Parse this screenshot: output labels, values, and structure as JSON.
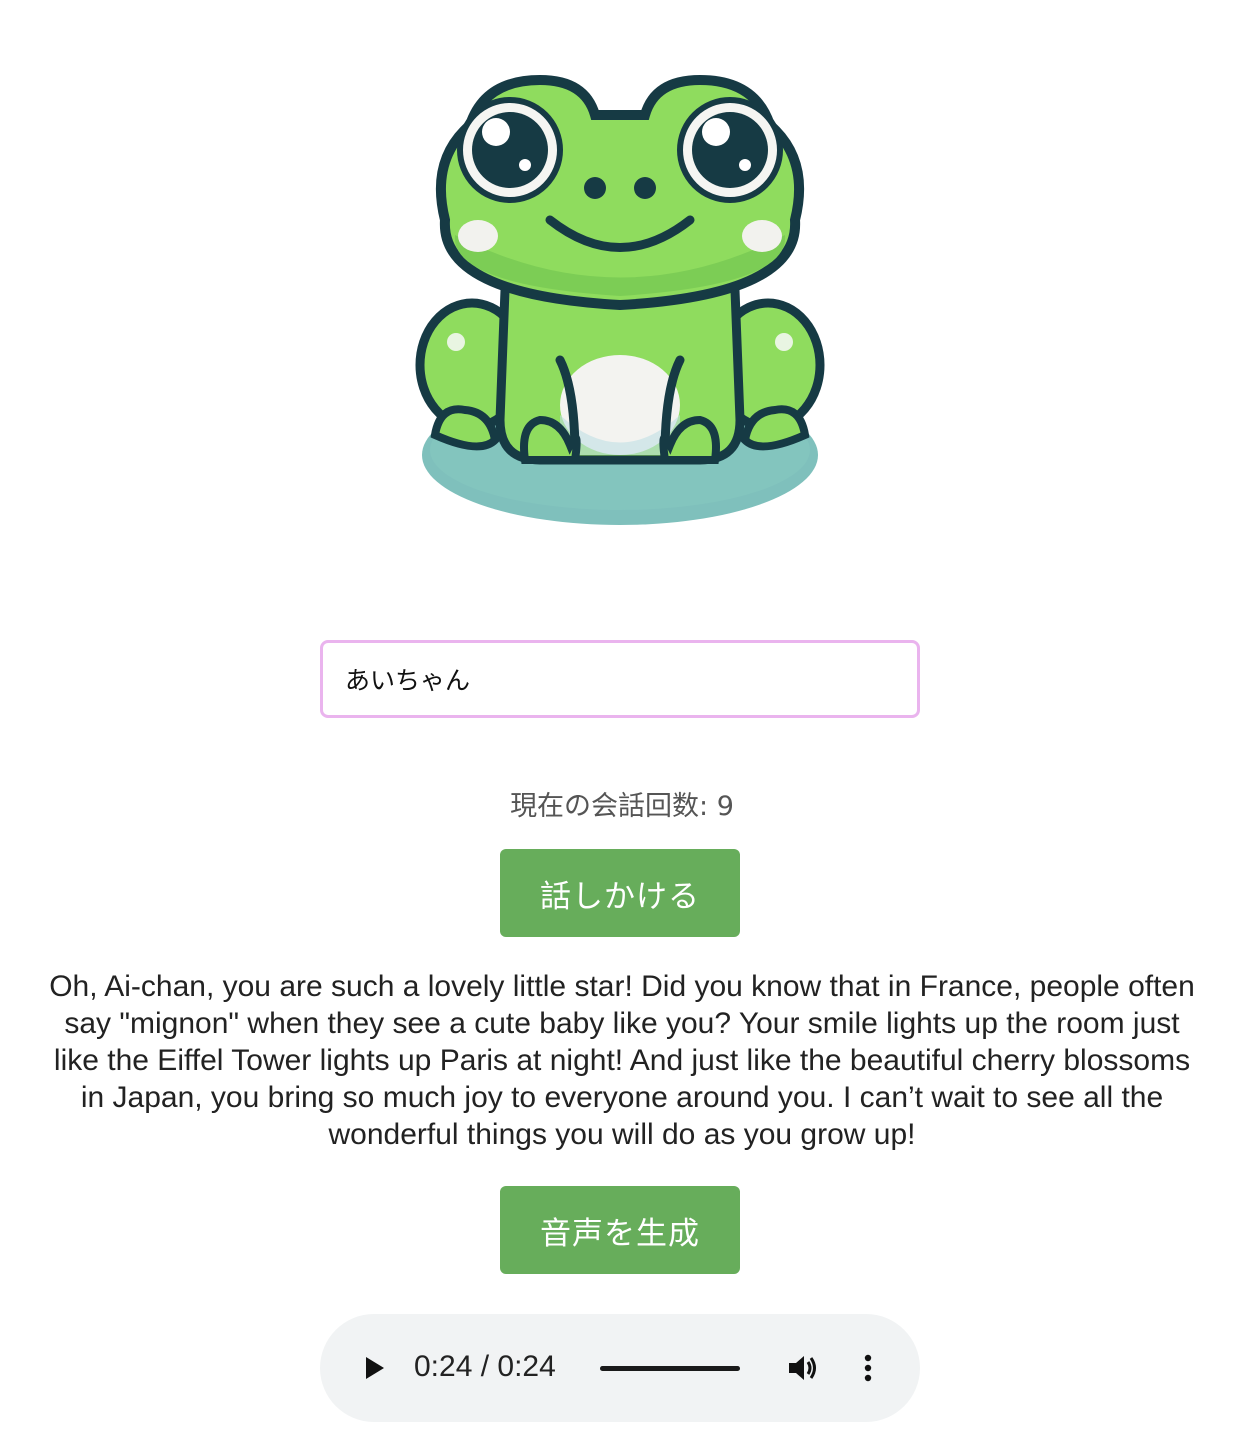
{
  "mascot": {
    "icon": "frog-mascot-icon",
    "colors": {
      "body": "#8fdc5e",
      "outline": "#163a44",
      "lily_pad": "#7fc0bc",
      "belly": "#f3f3f0"
    }
  },
  "name_input": {
    "value": "あいちゃん",
    "border_color": "#eab4ee"
  },
  "conversation": {
    "count_label": "現在の会話回数: 9"
  },
  "talk_button": {
    "label": "話しかける",
    "color": "#67ad5b"
  },
  "reply_text": "Oh, Ai-chan, you are such a lovely little star! Did you know that in France, people often say \"mignon\" when they see a cute baby like you? Your smile lights up the room just like the Eiffel Tower lights up Paris at night! And just like the beautiful cherry blossoms in Japan, you bring so much joy to everyone around you. I can’t wait to see all the wonderful things you will do as you grow up!",
  "voice_button": {
    "label": "音声を生成",
    "color": "#67ad5b"
  },
  "audio_player": {
    "time_display": "0:24 / 0:24",
    "progress": 1.0,
    "icons": [
      "play-icon",
      "volume-icon",
      "more-options-icon"
    ]
  }
}
